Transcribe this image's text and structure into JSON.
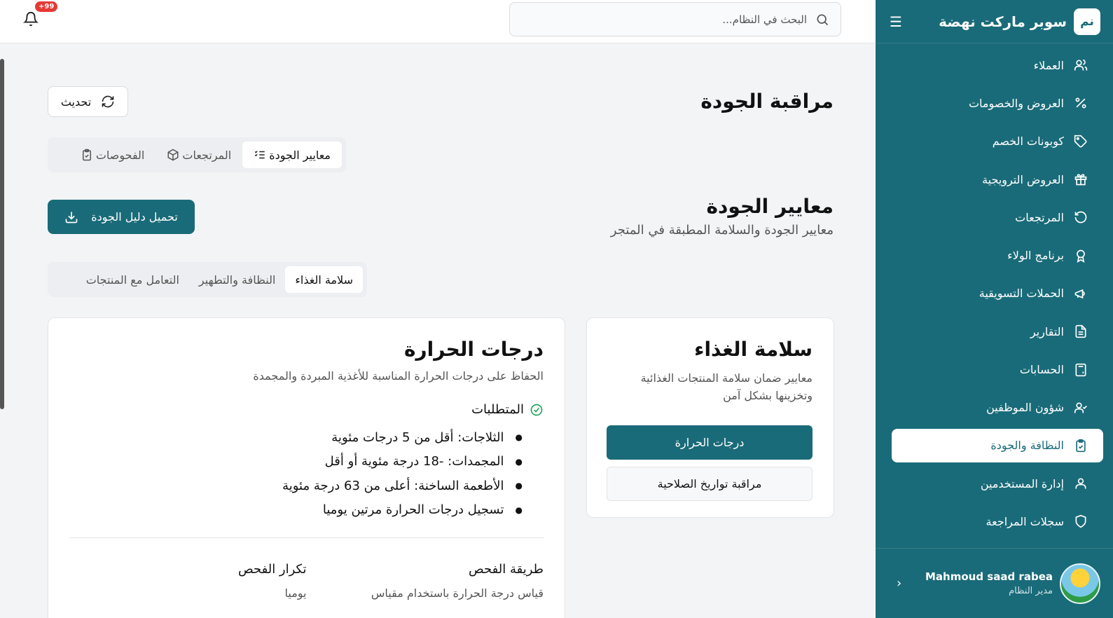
{
  "sidebar": {
    "logo": "نم",
    "title": "سوبر ماركت نهضة",
    "items": [
      {
        "label": "العملاء",
        "icon": "users-icon"
      },
      {
        "label": "العروض والخصومات",
        "icon": "percent-icon"
      },
      {
        "label": "كوبونات الخصم",
        "icon": "tag-icon"
      },
      {
        "label": "العروض الترويجية",
        "icon": "gift-icon"
      },
      {
        "label": "المرتجعات",
        "icon": "undo-icon"
      },
      {
        "label": "برنامج الولاء",
        "icon": "award-icon"
      },
      {
        "label": "الحملات التسويقية",
        "icon": "megaphone-icon"
      },
      {
        "label": "التقارير",
        "icon": "file-text-icon"
      },
      {
        "label": "الحسابات",
        "icon": "calculator-icon"
      },
      {
        "label": "شؤون الموظفين",
        "icon": "user-check-icon"
      },
      {
        "label": "النظافة والجودة",
        "icon": "clipboard-check-icon",
        "active": true
      },
      {
        "label": "إدارة المستخدمين",
        "icon": "user-icon"
      },
      {
        "label": "سجلات المراجعة",
        "icon": "shield-icon"
      }
    ],
    "user": {
      "name": "Mahmoud saad rabea",
      "role": "مدير النظام"
    }
  },
  "topbar": {
    "search_placeholder": "البحث في النظام...",
    "notifications_badge": "+99"
  },
  "page": {
    "title": "مراقبة الجودة",
    "refresh_label": "تحديث",
    "tabs": [
      {
        "label": "معايير الجودة",
        "icon": "list-check-icon",
        "active": true
      },
      {
        "label": "المرتجعات",
        "icon": "package-icon"
      },
      {
        "label": "الفحوصات",
        "icon": "clipboard-check-icon"
      }
    ]
  },
  "standards": {
    "title": "معايير الجودة",
    "subtitle": "معايير الجودة والسلامة المطبقة في المتجر",
    "download_label": "تحميل دليل الجودة",
    "subtabs": [
      {
        "label": "سلامة الغذاء",
        "active": true
      },
      {
        "label": "النظافة والتطهير"
      },
      {
        "label": "التعامل مع المنتجات"
      }
    ],
    "category_card": {
      "title": "سلامة الغذاء",
      "description": "معايير ضمان سلامة المنتجات الغذائية وتخزينها بشكل آمن",
      "buttons": [
        "درجات الحرارة",
        "مراقبة تواريخ الصلاحية"
      ]
    },
    "detail_card": {
      "title": "درجات الحرارة",
      "subtitle": "الحفاظ على درجات الحرارة المناسبة للأغذية المبردة والمجمدة",
      "requirements_label": "المتطلبات",
      "requirements": [
        "الثلاجات: أقل من 5 درجات مئوية",
        "المجمدات: -18 درجة مئوية أو أقل",
        "الأطعمة الساخنة: أعلى من 63 درجة مئوية",
        "تسجيل درجات الحرارة مرتين يوميا"
      ],
      "method_label": "طريقة الفحص",
      "method_value": "قياس درجة الحرارة باستخدام مقياس",
      "frequency_label": "تكرار الفحص",
      "frequency_value": "يوميا"
    }
  },
  "colors": {
    "primary": "#1a6b79",
    "badge": "#e53935",
    "check": "#22a45d"
  }
}
